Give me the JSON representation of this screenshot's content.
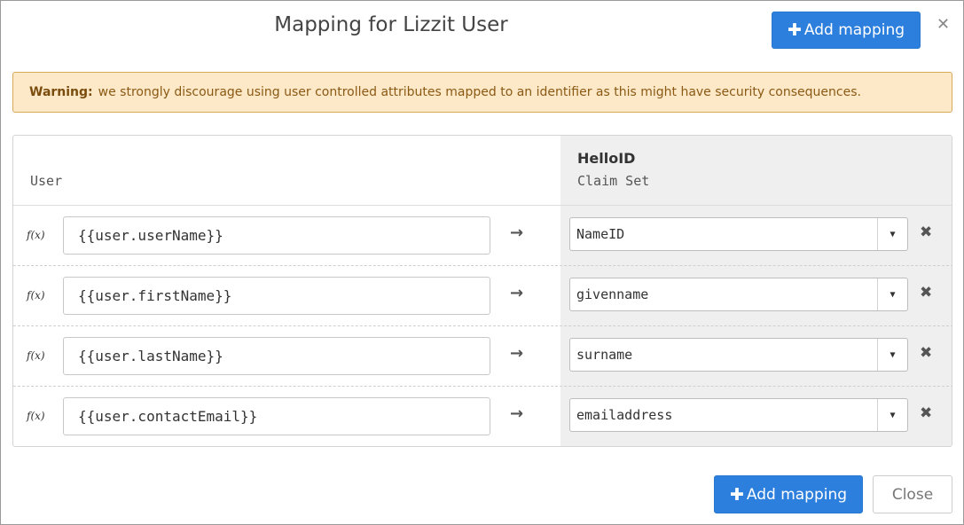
{
  "dialog": {
    "title": "Mapping for Lizzit User",
    "add_mapping_label": "Add mapping",
    "close_icon": "close-icon"
  },
  "warning": {
    "label": "Warning:",
    "text": "we strongly discourage using user controlled attributes mapped to an identifier as this might have security consequences."
  },
  "table": {
    "left_header": "User",
    "right_header_title": "HelloID",
    "right_header_subtitle": "Claim Set",
    "rows": [
      {
        "fx": "f(x)",
        "expression": "{{user.userName}}",
        "arrow": "→",
        "claim": "NameID"
      },
      {
        "fx": "f(x)",
        "expression": "{{user.firstName}}",
        "arrow": "→",
        "claim": "givenname"
      },
      {
        "fx": "f(x)",
        "expression": "{{user.lastName}}",
        "arrow": "→",
        "claim": "surname"
      },
      {
        "fx": "f(x)",
        "expression": "{{user.contactEmail}}",
        "arrow": "→",
        "claim": "emailaddress"
      }
    ]
  },
  "footer": {
    "add_mapping_label": "Add mapping",
    "close_label": "Close"
  },
  "colors": {
    "primary": "#2c7fdc",
    "warning_bg": "#fde8c8",
    "warning_text": "#8a5a14"
  }
}
